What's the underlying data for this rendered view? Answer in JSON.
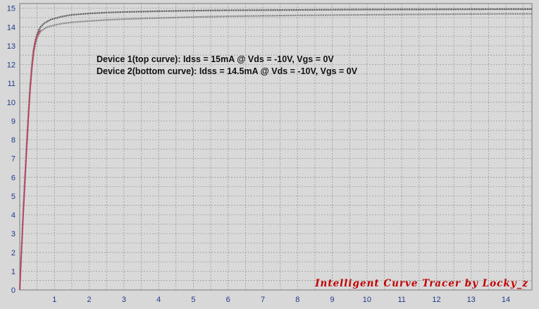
{
  "chart_data": {
    "type": "line",
    "xlim": [
      0,
      14.75
    ],
    "ylim": [
      0,
      15.25
    ],
    "x_ticks": [
      "1",
      "2",
      "3",
      "4",
      "5",
      "6",
      "7",
      "8",
      "9",
      "10",
      "11",
      "12",
      "13",
      "14"
    ],
    "y_ticks": [
      "0",
      "1",
      "2",
      "3",
      "4",
      "5",
      "6",
      "7",
      "8",
      "9",
      "10",
      "11",
      "12",
      "13",
      "14",
      "15"
    ],
    "grid": true,
    "annotations": [
      "Device 1(top curve): Idss = 15mA @ Vds = -10V, Vgs = 0V",
      "Device 2(bottom curve): Idss = 14.5mA @ Vds = -10V, Vgs = 0V"
    ],
    "watermark": "Intelligent Curve Tracer by Locky_z",
    "series": [
      {
        "color": "#444444",
        "x": [
          0,
          0.05,
          0.1,
          0.15,
          0.2,
          0.25,
          0.3,
          0.35,
          0.4,
          0.45,
          0.5,
          0.55,
          0.6,
          0.7,
          0.8,
          0.9,
          1.0,
          1.2,
          1.5,
          2,
          2.5,
          3,
          4,
          5,
          6,
          8,
          10,
          12,
          14,
          14.75
        ],
        "y": [
          0,
          2.2,
          4.2,
          6.0,
          7.8,
          9.4,
          10.9,
          12.0,
          12.8,
          13.3,
          13.6,
          13.85,
          14.0,
          14.2,
          14.3,
          14.4,
          14.45,
          14.55,
          14.65,
          14.72,
          14.77,
          14.8,
          14.84,
          14.87,
          14.89,
          14.91,
          14.93,
          14.94,
          14.95,
          14.95
        ]
      },
      {
        "color": "#777777",
        "x": [
          0,
          0.05,
          0.1,
          0.15,
          0.2,
          0.25,
          0.3,
          0.35,
          0.4,
          0.45,
          0.5,
          0.55,
          0.6,
          0.7,
          0.8,
          0.9,
          1.0,
          1.2,
          1.5,
          2,
          2.5,
          3,
          4,
          5,
          6,
          8,
          10,
          12,
          14,
          14.75
        ],
        "y": [
          0,
          2.1,
          4.0,
          5.8,
          7.6,
          9.2,
          10.7,
          11.8,
          12.6,
          13.1,
          13.4,
          13.6,
          13.75,
          13.9,
          14.0,
          14.05,
          14.1,
          14.18,
          14.25,
          14.32,
          14.38,
          14.42,
          14.48,
          14.53,
          14.57,
          14.62,
          14.65,
          14.68,
          14.7,
          14.7
        ]
      },
      {
        "color": "#cc3355",
        "x": [
          0,
          0.05,
          0.1,
          0.15,
          0.2,
          0.25,
          0.3,
          0.35,
          0.4,
          0.45,
          0.5,
          0.55,
          0.6
        ],
        "y": [
          0,
          2.0,
          3.9,
          5.7,
          7.5,
          9.1,
          10.6,
          11.8,
          12.7,
          13.2,
          13.5,
          13.7,
          13.85
        ]
      }
    ]
  }
}
